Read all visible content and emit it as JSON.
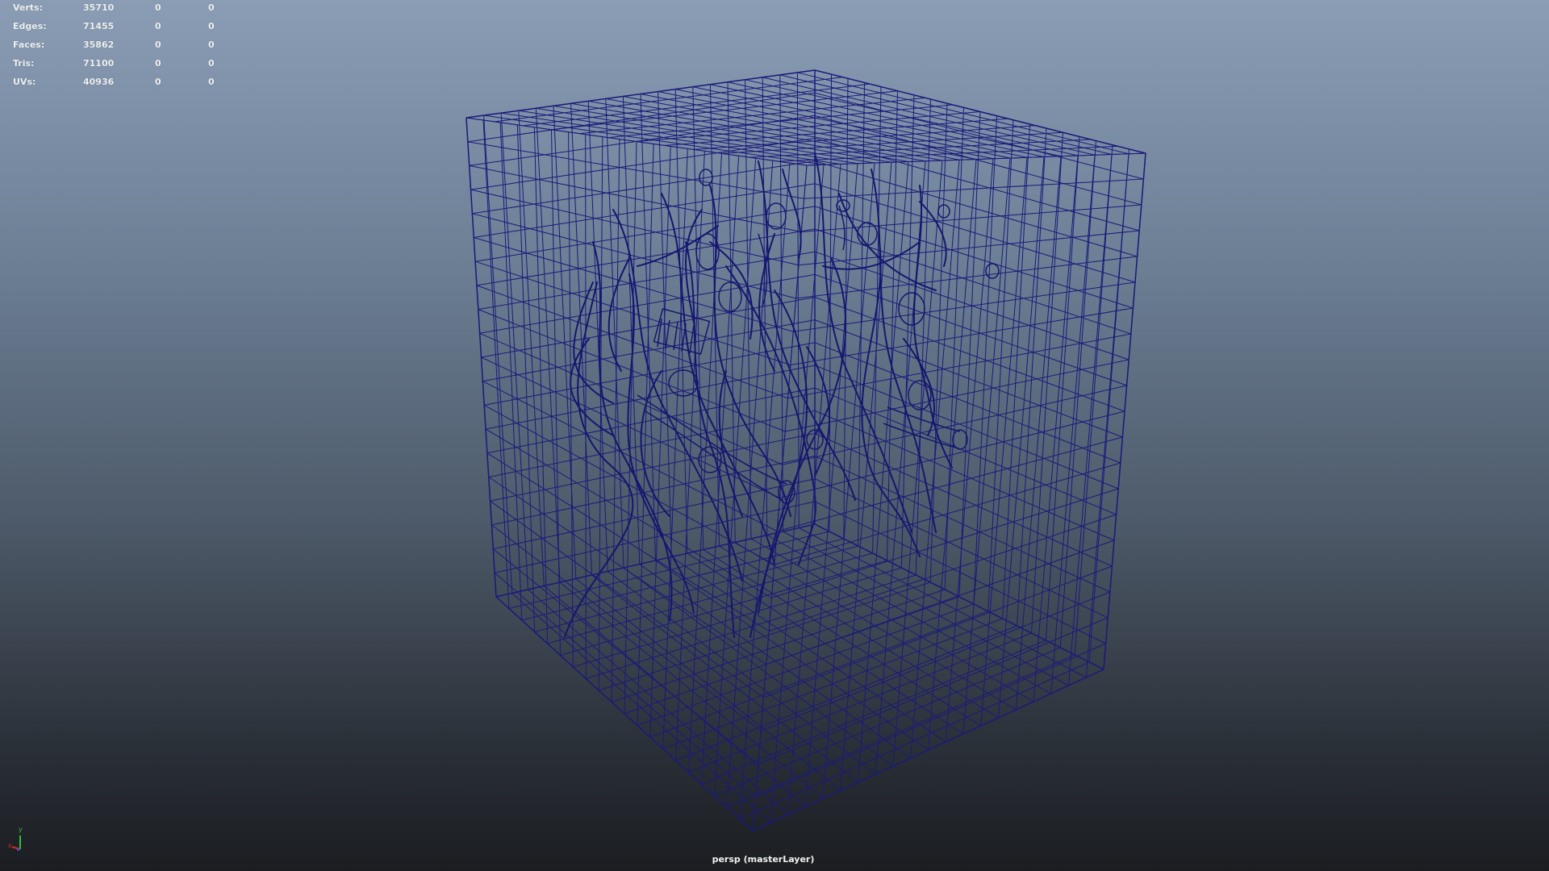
{
  "hud": {
    "rows": [
      {
        "label": "Verts:",
        "values": [
          "35710",
          "0",
          "0"
        ]
      },
      {
        "label": "Edges:",
        "values": [
          "71455",
          "0",
          "0"
        ]
      },
      {
        "label": "Faces:",
        "values": [
          "35862",
          "0",
          "0"
        ]
      },
      {
        "label": "Tris:",
        "values": [
          "71100",
          "0",
          "0"
        ]
      },
      {
        "label": "UVs:",
        "values": [
          "40936",
          "0",
          "0"
        ]
      }
    ]
  },
  "viewport": {
    "camera_label": "persp (masterLayer)",
    "axis": {
      "y": "y",
      "x": "x"
    }
  },
  "colors": {
    "wireframe": "#1b1a7a",
    "axis_x": "#d22a2a",
    "axis_y": "#2fbf3c",
    "axis_z": "#3a55e0",
    "hud_text": "#eef0f2"
  }
}
